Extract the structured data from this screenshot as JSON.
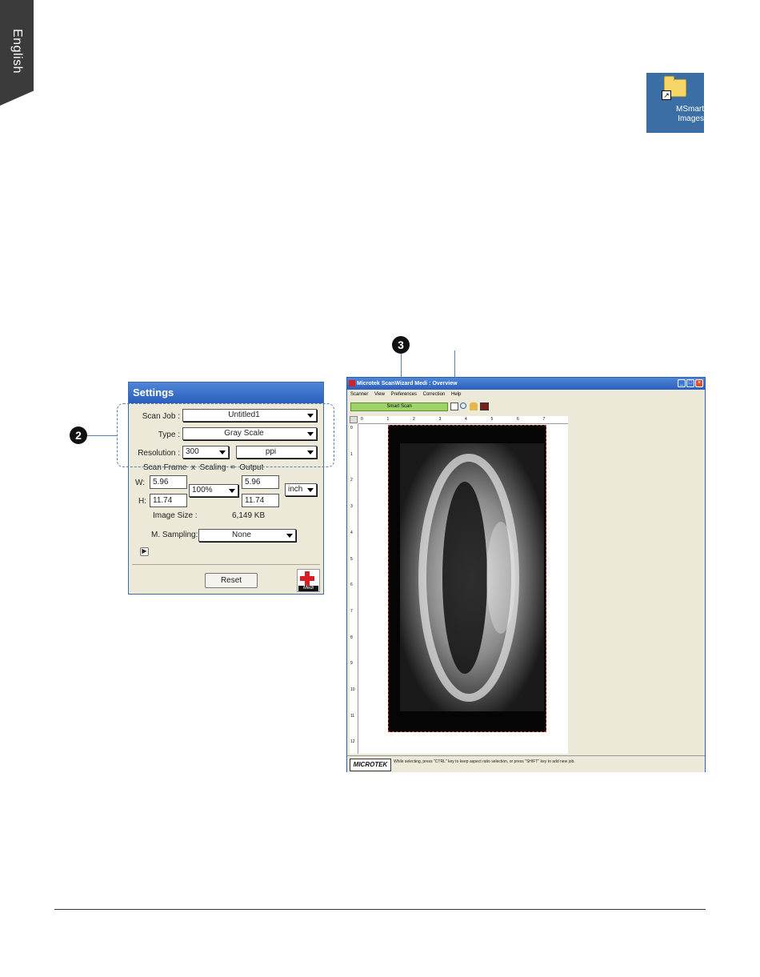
{
  "lang_tab": "English",
  "desktop_shortcut": {
    "label_line1": "MSmart",
    "label_line2": "Images",
    "arrow": "↗"
  },
  "callouts": [
    "2",
    "3"
  ],
  "settings": {
    "title": "Settings",
    "scan_job_label": "Scan Job :",
    "scan_job_value": "Untitled1",
    "type_label": "Type :",
    "type_value": "Gray Scale",
    "resolution_label": "Resolution :",
    "resolution_value": "300",
    "resolution_unit": "ppi",
    "header_scan_frame": "Scan Frame",
    "header_x": "x",
    "header_scaling": "Scaling",
    "header_eq": "=",
    "header_output": "Output",
    "w_label": "W:",
    "w_value": "5.96",
    "h_label": "H:",
    "h_value": "11.74",
    "scaling_value": "100%",
    "out_w": "5.96",
    "out_h": "11.74",
    "unit_value": "inch",
    "image_size_label": "Image Size :",
    "image_size_value": "6,149 KB",
    "m_sampling_label": "M. Sampling:",
    "m_sampling_value": "None",
    "reset_label": "Reset",
    "logo_text": "Medi"
  },
  "scanwizard": {
    "title": "Microtek ScanWizard Medi : Overview",
    "menu": [
      "Scanner",
      "View",
      "Preferences",
      "Correction",
      "Help"
    ],
    "smart_scan_label": "Smart Scan",
    "ruler_top": [
      "0",
      "1",
      "2",
      "3",
      "4",
      "5",
      "6",
      "7"
    ],
    "ruler_left": [
      "0",
      "1",
      "2",
      "3",
      "4",
      "5",
      "6",
      "7",
      "8",
      "9",
      "10",
      "11",
      "12"
    ],
    "brand": "MICROTEK",
    "status_text": "While selecting, press \"CTRL\" key to keep aspect ratio selection, or press \"SHIFT\" key to add new job.",
    "colors": {
      "title_bar": "#2a5fbd",
      "smart_scan": "#9ed36a",
      "window_bg": "#ece9d8"
    }
  }
}
